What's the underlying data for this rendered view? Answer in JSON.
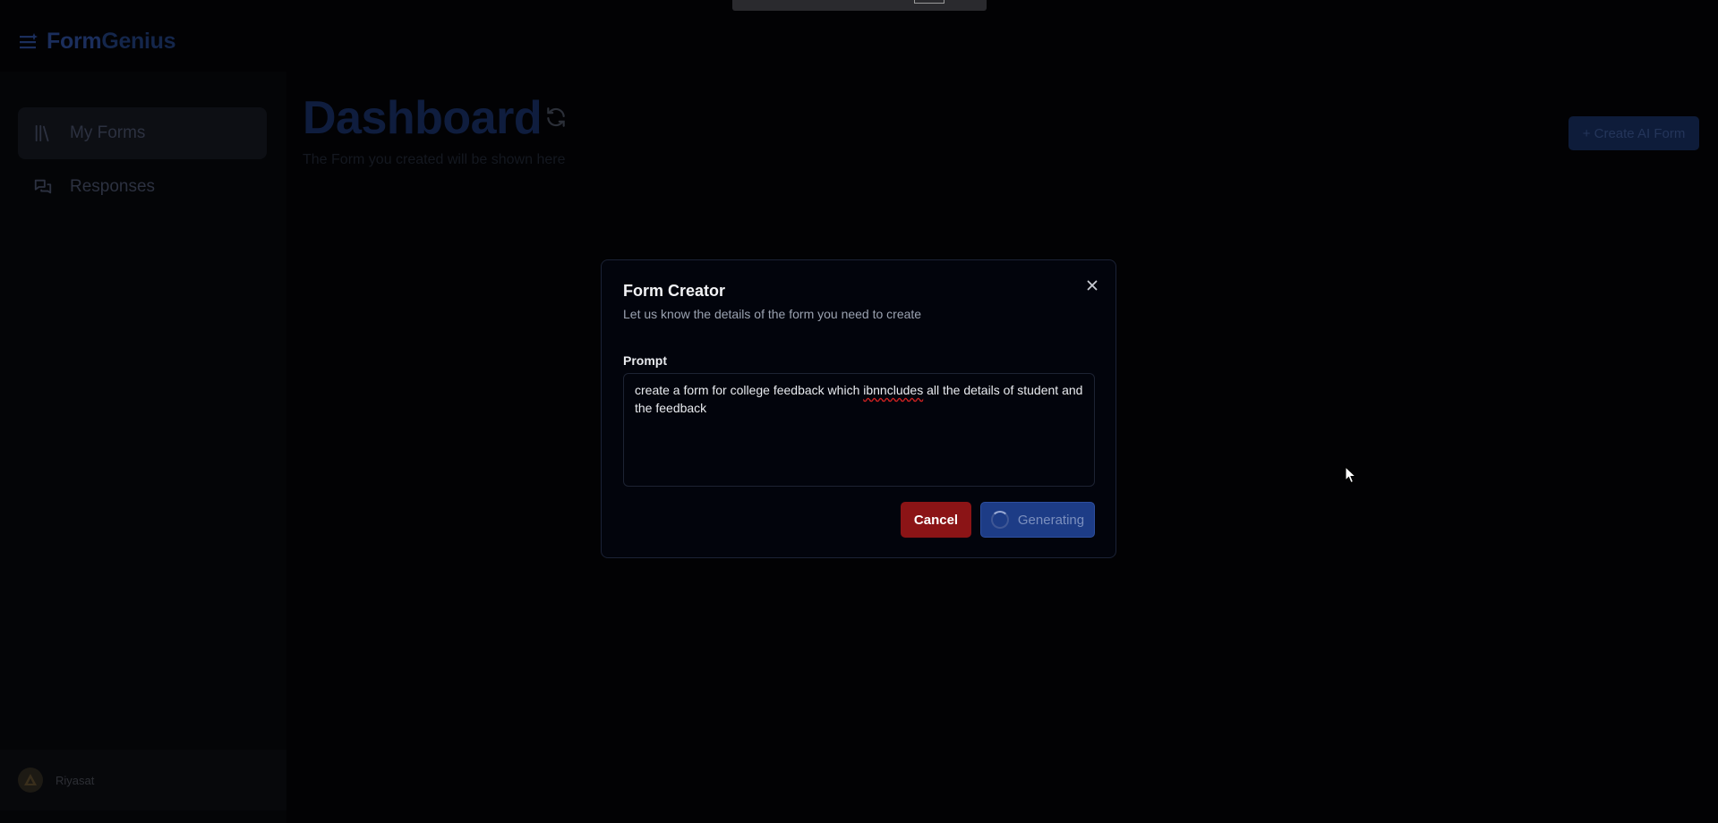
{
  "app": {
    "brand_part1": "Form",
    "brand_part2": "Genius"
  },
  "sidebar": {
    "items": [
      {
        "label": "My Forms",
        "icon": "library-icon",
        "active": true
      },
      {
        "label": "Responses",
        "icon": "chat-bubbles-icon",
        "active": false
      }
    ],
    "user": {
      "name": "Riyasat"
    }
  },
  "main": {
    "title": "Dashboard",
    "subtitle": "The Form you created will be shown here",
    "create_button": "+ Create AI Form"
  },
  "modal": {
    "title": "Form Creator",
    "description": "Let us know the details of the form you need to create",
    "prompt_label": "Prompt",
    "prompt_value_before": "create a form for college feedback which ",
    "prompt_value_typo": "ibnncludes",
    "prompt_value_after": " all the details of student and the feedback",
    "cancel_label": "Cancel",
    "generate_label": "Generating"
  },
  "colors": {
    "accent": "#1d3c86",
    "danger": "#8b1416",
    "background": "#020204"
  }
}
